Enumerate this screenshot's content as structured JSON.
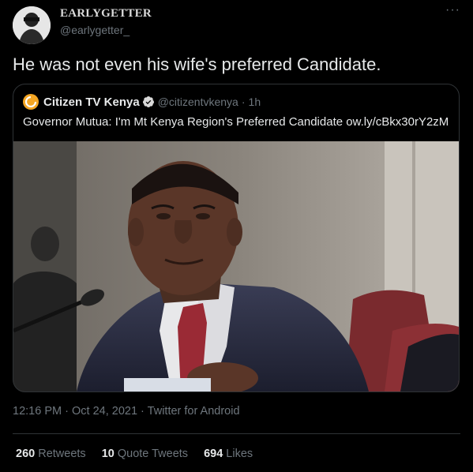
{
  "author": {
    "display_name": "EARLYGETTER",
    "handle": "@earlygetter_"
  },
  "more_label": "···",
  "tweet": {
    "text": "He was not even his wife's preferred Candidate."
  },
  "quoted": {
    "avatar_letter": "C",
    "name": "Citizen TV Kenya",
    "handle": "@citizentvkenya",
    "separator": "·",
    "time": "1h",
    "text": "Governor Mutua: I'm Mt Kenya Region's Preferred Candidate ow.ly/cBkx30rY2zM"
  },
  "meta": {
    "time": "12:16 PM",
    "date": "Oct 24, 2021",
    "sep": "·",
    "source": "Twitter for Android"
  },
  "stats": {
    "retweets_count": "260",
    "retweets_label": "Retweets",
    "quotes_count": "10",
    "quotes_label": "Quote Tweets",
    "likes_count": "694",
    "likes_label": "Likes"
  },
  "colors": {
    "background": "#000000",
    "secondary_text": "#6e767d",
    "verified": "#1d9bf0",
    "citizen_accent": "#f5a623"
  },
  "icons": [
    "verified-badge-icon",
    "more-options-icon"
  ]
}
